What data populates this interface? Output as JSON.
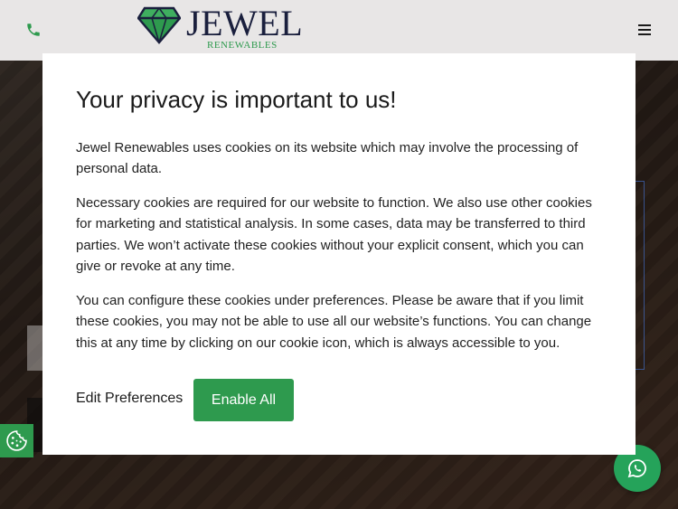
{
  "header": {
    "logo_word": "JEWEL",
    "logo_sub": "RENEWABLES",
    "brand_color": "#2e9a4e",
    "phone_icon": "phone-icon",
    "menu_icon": "hamburger-menu-icon"
  },
  "modal": {
    "title": "Your privacy is important to us!",
    "paragraph_1": "Jewel Renewables uses cookies on its website which may involve the processing of personal data.",
    "paragraph_2": "Necessary cookies are required for our website to function. We also use other cookies for marketing and statistical analysis. In some cases, data may be transferred to third parties. We won’t activate these cookies without your explicit consent, which you can give or revoke at any time.",
    "paragraph_3": "You can configure these cookies under preferences. Please be aware that if you limit these cookies, you may not be able to use all our website’s functions. You can change this at any time by clicking on our cookie icon, which is always accessible to you.",
    "edit_preferences_label": "Edit Preferences",
    "enable_all_label": "Enable All"
  },
  "floating": {
    "cookie_icon": "cookie-icon",
    "whatsapp_icon": "whatsapp-icon"
  }
}
